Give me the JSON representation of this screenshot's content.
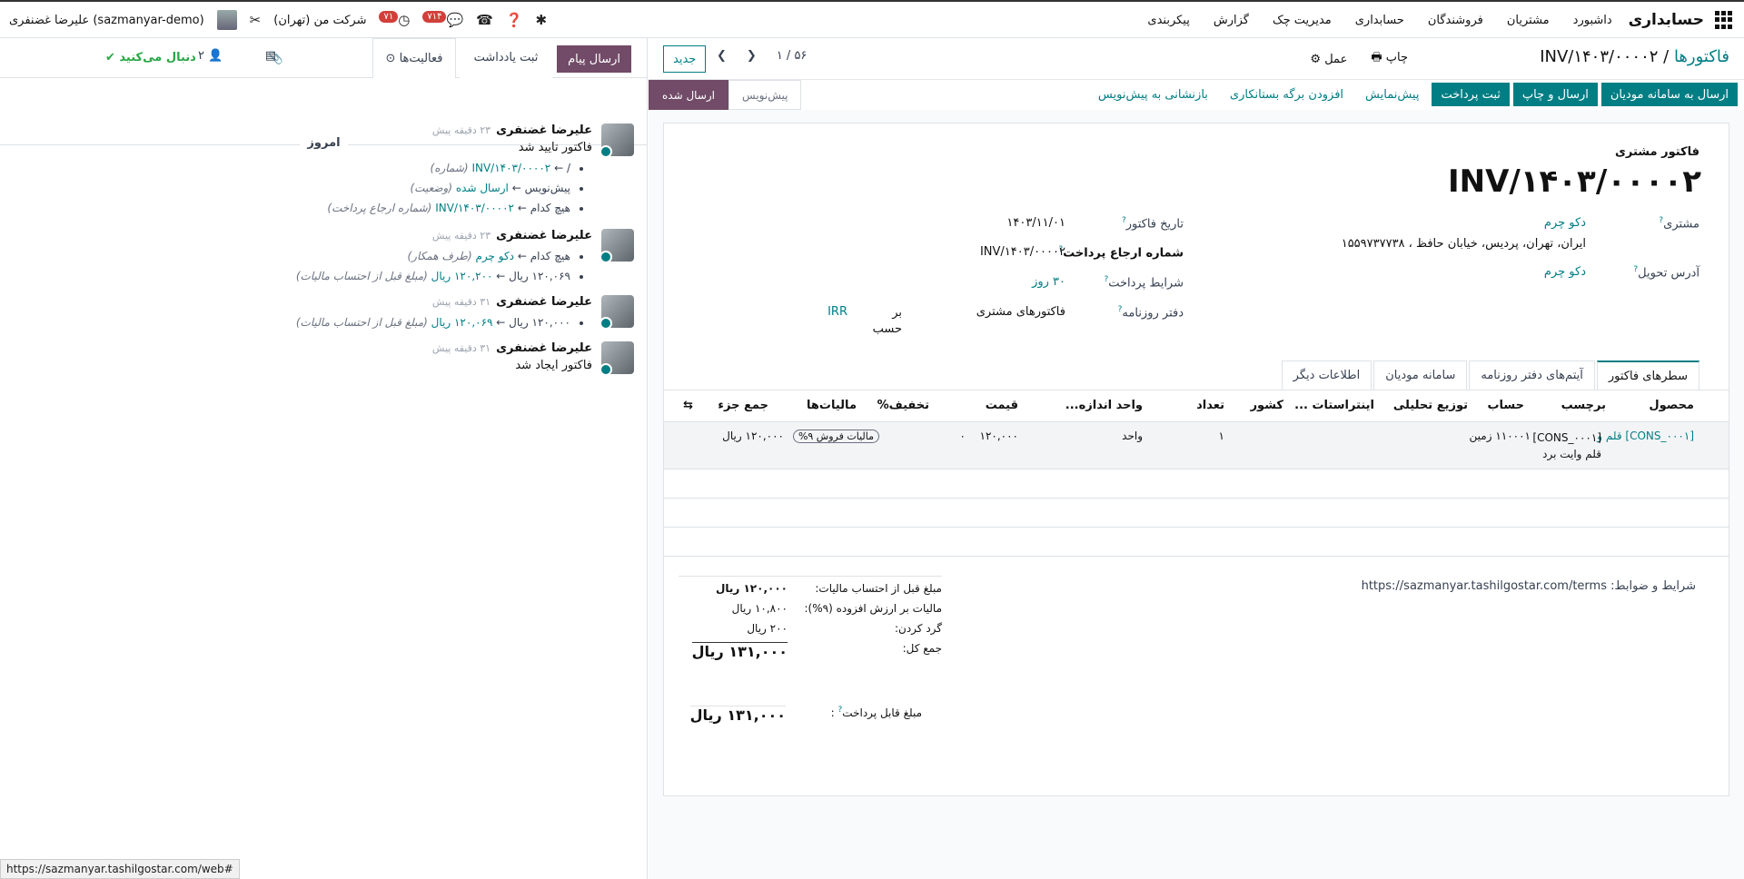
{
  "navbar": {
    "app_title": "حسابداری",
    "menus": [
      "داشبورد",
      "مشتریان",
      "فروشندگان",
      "حسابداری",
      "مدیریت چک",
      "گزارش",
      "پیکربندی"
    ],
    "company": "شرکت من (تهران)",
    "user": "علیرضا غضنفری (sazmanyar-demo)",
    "messages_badge": "۷۱۴",
    "activity_badge": "۷۱"
  },
  "chatter": {
    "send_message": "ارسال پیام",
    "log_note": "ثبت یادداشت",
    "activities": "فعالیت‌ها",
    "followers_count": "۲",
    "following": "دنبال می‌کنید",
    "today": "امروز",
    "messages": [
      {
        "author": "علیرضا غضنفری",
        "time": "۲۳ دقیقه پیش",
        "text": "فاکتور تایید شد",
        "changes": [
          {
            "old": "/",
            "new": "INV/۱۴۰۳/۰۰۰۰۲",
            "field": "(شماره)"
          },
          {
            "old": "پیش‌نویس",
            "new": "ارسال شده",
            "field": "(وضعیت)"
          },
          {
            "old": "هیچ کدام",
            "new": "INV/۱۴۰۳/۰۰۰۰۲",
            "field": "(شماره ارجاع پرداخت)"
          }
        ]
      },
      {
        "author": "علیرضا غضنفری",
        "time": "۲۳ دقیقه پیش",
        "text": "",
        "changes": [
          {
            "old": "هیچ کدام",
            "new": "دکو چرم",
            "field": "(طرف همکار)"
          },
          {
            "old": "۱۲۰,۰۶۹ ریال",
            "new": "۱۲۰,۲۰۰ ریال",
            "field": "(مبلغ قبل از احتساب مالیات)"
          }
        ]
      },
      {
        "author": "علیرضا غضنفری",
        "time": "۳۱ دقیقه پیش",
        "text": "",
        "changes": [
          {
            "old": "۱۲۰,۰۰۰ ریال",
            "new": "۱۲۰,۰۶۹ ریال",
            "field": "(مبلغ قبل از احتساب مالیات)"
          }
        ]
      },
      {
        "author": "علیرضا غضنفری",
        "time": "۳۱ دقیقه پیش",
        "text": "فاکتور ایجاد شد",
        "changes": []
      }
    ]
  },
  "control_panel": {
    "breadcrumb_parent": "فاکتورها",
    "breadcrumb_current": "INV/۱۴۰۳/۰۰۰۰۲",
    "print": "چاپ",
    "action": "عمل",
    "pager": "۱ / ۵۶",
    "new_button": "جدید"
  },
  "status_buttons": [
    "ارسال به سامانه مودیان",
    "ارسال و چاپ",
    "ثبت پرداخت",
    "پیش‌نمایش",
    "افزودن برگه بستانکاری",
    "بازنشانی به پیش‌نویس"
  ],
  "stages": [
    "پیش‌نویس",
    "ارسال شده"
  ],
  "form": {
    "type_label": "فاکتور مشتری",
    "number": "INV/۱۴۰۳/۰۰۰۰۲",
    "customer_label": "مشتری",
    "customer": "دکو چرم",
    "customer_address": "ایران، تهران، پردیس، خیابان حافظ ، ۱۵۵۹۷۳۷۷۳۸",
    "delivery_label": "آدرس تحویل",
    "delivery": "دکو چرم",
    "invoice_date_label": "تاریخ فاکتور",
    "invoice_date": "۱۴۰۳/۱۱/۰۱",
    "payment_ref_label": "شماره ارجاع پرداخت",
    "payment_ref": "INV/۱۴۰۳/۰۰۰۰۲",
    "payment_terms_label": "شرایط پرداخت",
    "payment_terms": "۳۰ روز",
    "journal_label": "دفتر روزنامه",
    "journal": "فاکتورهای مشتری",
    "journal_in": "بر حسب",
    "currency": "IRR"
  },
  "tabs": [
    "سطرهای فاکتور",
    "آیتم‌های دفتر روزنامه",
    "سامانه مودیان",
    "اطلاعات دیگر"
  ],
  "table": {
    "headers": [
      "محصول",
      "برچسب",
      "حساب",
      "توزیع تحلیلی",
      "اینتراستات ...",
      "کشور",
      "تعداد",
      "واحد اندازه...",
      "قیمت",
      "تخفیف%",
      "مالیات‌ها",
      "جمع جزء"
    ],
    "rows": [
      {
        "product": "[CONS_۰۰۰۱] قلم و",
        "label": "[CONS_۰۰۰۱] قلم وایت برد",
        "account": "۱۱۰۰۰۱ زمین",
        "qty": "۱",
        "uom": "واحد",
        "price": "۱۲۰,۰۰۰",
        "discount": "۰",
        "tax": "مالیات فروش ۹%",
        "subtotal": "۱۲۰,۰۰۰ ریال"
      }
    ]
  },
  "terms": "شرایط و ضوابط: https://sazmanyar.tashilgostar.com/terms",
  "totals": {
    "untaxed_label": "مبلغ قبل از احتساب مالیات:",
    "untaxed": "۱۲۰,۰۰۰ ریال",
    "vat_label": "مالیات بر ارزش افزوده (۹%):",
    "vat": "۱۰,۸۰۰ ریال",
    "rounding_label": "گرد کردن:",
    "rounding": "۲۰۰ ریال",
    "total_label": "جمع کل:",
    "total": "۱۳۱,۰۰۰ ریال",
    "due_label": "مبلغ قابل پرداخت",
    "due": "۱۳۱,۰۰۰ ریال"
  },
  "status_url": "https://sazmanyar.tashilgostar.com/web#"
}
